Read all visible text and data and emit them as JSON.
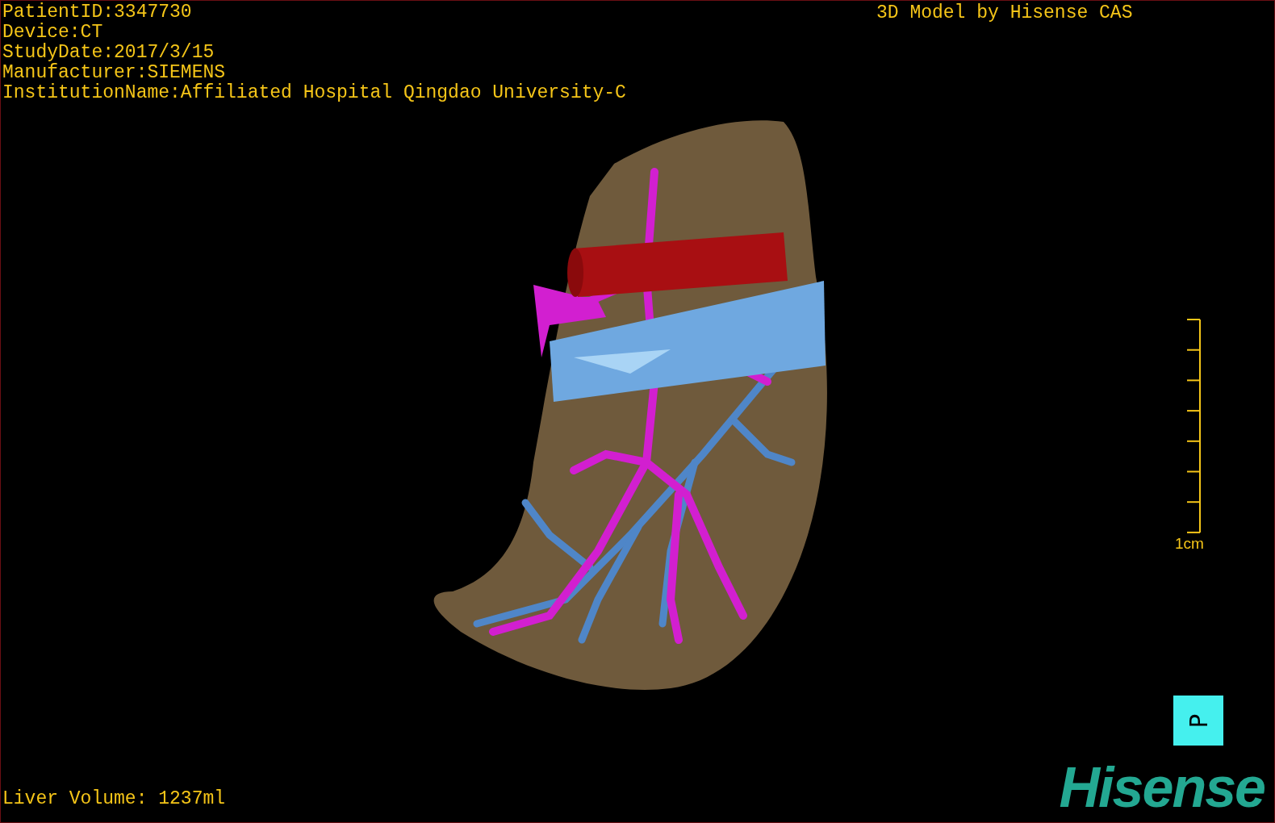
{
  "study_info": [
    "PatientID:3347730",
    "Device:CT",
    "StudyDate:2017/3/15",
    "Manufacturer:SIEMENS",
    "InstitutionName:Affiliated Hospital Qingdao University-C"
  ],
  "model_title": "3D Model by Hisense CAS",
  "scale_bar": {
    "label": "1cm"
  },
  "orientation_cube": {
    "label": "P"
  },
  "liver_volume": "Liver Volume: 1237ml",
  "logo": "Hisense"
}
